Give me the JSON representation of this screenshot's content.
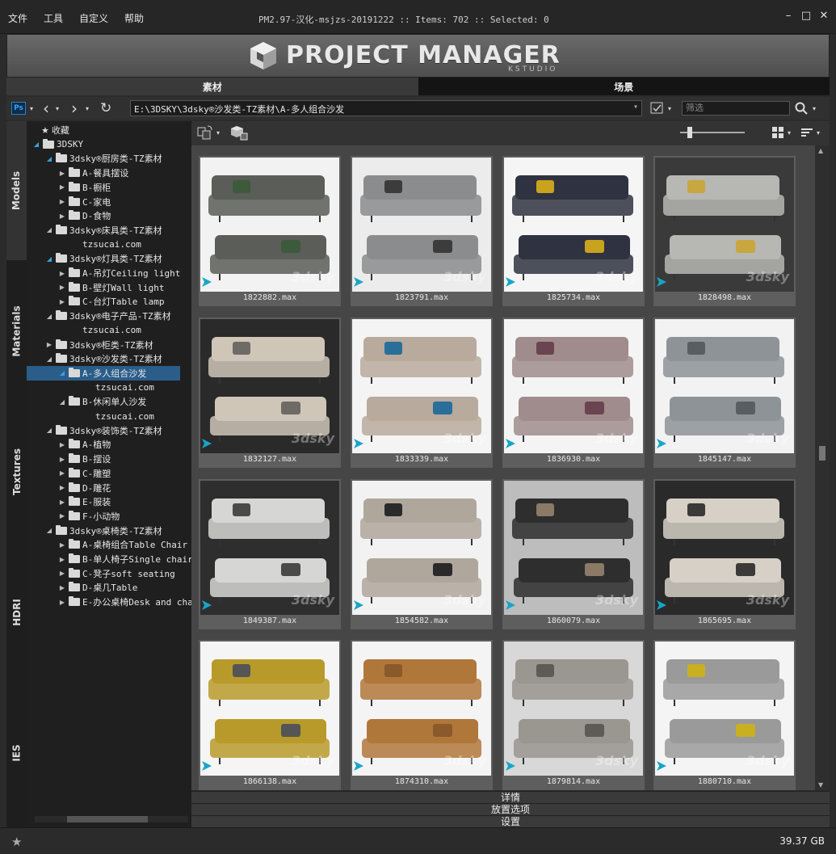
{
  "menu": [
    "文件",
    "工具",
    "自定义",
    "帮助"
  ],
  "window_title": "PM2.97-汉化-msjzs-20191222  :: Items: 702  :: Selected: 0",
  "logo": {
    "title": "PROJECT MANAGER",
    "subtitle": "KSTUDIO"
  },
  "main_tabs": [
    {
      "label": "素材",
      "active": true
    },
    {
      "label": "场景",
      "active": false
    }
  ],
  "address": {
    "path": "E:\\3DSKY\\3dsky®沙发类-TZ素材\\A-多人组合沙发",
    "filter_placeholder": "筛选"
  },
  "side_tabs": [
    "Models",
    "Materials",
    "Textures",
    "HDRI",
    "IES"
  ],
  "tree": [
    {
      "label": "收藏",
      "level": 0,
      "arrow": "",
      "star": true
    },
    {
      "label": "3DSKY",
      "level": 0,
      "arrow": "open"
    },
    {
      "label": "3dsky®厨房类-TZ素材",
      "level": 1,
      "arrow": "open"
    },
    {
      "label": "A-餐具摆设",
      "level": 2,
      "arrow": "closed"
    },
    {
      "label": "B-橱柜",
      "level": 2,
      "arrow": "closed"
    },
    {
      "label": "C-家电",
      "level": 2,
      "arrow": "closed"
    },
    {
      "label": "D-食物",
      "level": 2,
      "arrow": "closed"
    },
    {
      "label": "3dsky®床具类-TZ素材",
      "level": 1,
      "arrow": "open2"
    },
    {
      "label": "tzsucai.com",
      "level": 2,
      "arrow": ""
    },
    {
      "label": "3dsky®灯具类-TZ素材",
      "level": 1,
      "arrow": "open"
    },
    {
      "label": "A-吊灯Ceiling light",
      "level": 2,
      "arrow": "closed"
    },
    {
      "label": "B-壁灯Wall light",
      "level": 2,
      "arrow": "closed"
    },
    {
      "label": "C-台灯Table lamp",
      "level": 2,
      "arrow": "closed"
    },
    {
      "label": "3dsky®电子产品-TZ素材",
      "level": 1,
      "arrow": "open2"
    },
    {
      "label": "tzsucai.com",
      "level": 2,
      "arrow": ""
    },
    {
      "label": "3dsky®柜类-TZ素材",
      "level": 1,
      "arrow": "closed"
    },
    {
      "label": "3dsky®沙发类-TZ素材",
      "level": 1,
      "arrow": "open2"
    },
    {
      "label": "A-多人组合沙发",
      "level": 2,
      "arrow": "open",
      "selected": true
    },
    {
      "label": "tzsucai.com",
      "level": 3,
      "arrow": ""
    },
    {
      "label": "B-休闲单人沙发",
      "level": 2,
      "arrow": "open2"
    },
    {
      "label": "tzsucai.com",
      "level": 3,
      "arrow": ""
    },
    {
      "label": "3dsky®装饰类-TZ素材",
      "level": 1,
      "arrow": "open2"
    },
    {
      "label": "A-植物",
      "level": 2,
      "arrow": "closed"
    },
    {
      "label": "B-摆设",
      "level": 2,
      "arrow": "closed"
    },
    {
      "label": "C-雕塑",
      "level": 2,
      "arrow": "closed"
    },
    {
      "label": "D-雕花",
      "level": 2,
      "arrow": "closed"
    },
    {
      "label": "E-服装",
      "level": 2,
      "arrow": "closed"
    },
    {
      "label": "F-小动物",
      "level": 2,
      "arrow": "closed"
    },
    {
      "label": "3dsky®桌椅类-TZ素材",
      "level": 1,
      "arrow": "open2"
    },
    {
      "label": "A-桌椅组合Table Chair",
      "level": 2,
      "arrow": "closed"
    },
    {
      "label": "B-单人椅子Single chair",
      "level": 2,
      "arrow": "closed"
    },
    {
      "label": "C-凳子soft seating",
      "level": 2,
      "arrow": "closed"
    },
    {
      "label": "D-桌几Table",
      "level": 2,
      "arrow": "closed"
    },
    {
      "label": "E-办公桌椅Desk and chair",
      "level": 2,
      "arrow": "closed"
    }
  ],
  "items": [
    {
      "file": "1822882.max",
      "colors": [
        "#f2f2f2",
        "#5a5d58",
        "#3e5a3c"
      ]
    },
    {
      "file": "1823791.max",
      "colors": [
        "#ececec",
        "#8a8c8e",
        "#3c3c3c"
      ]
    },
    {
      "file": "1825734.max",
      "colors": [
        "#f5f5f5",
        "#2f3240",
        "#c9a21e"
      ]
    },
    {
      "file": "1828498.max",
      "colors": [
        "#3a3a3a",
        "#b7b7b4",
        "#c8a640"
      ]
    },
    {
      "file": "1832127.max",
      "colors": [
        "#2a2a2a",
        "#cfc6b8",
        "#6e6a66"
      ]
    },
    {
      "file": "1833339.max",
      "colors": [
        "#f4f4f4",
        "#b8aa9c",
        "#2a6e9a"
      ]
    },
    {
      "file": "1836930.max",
      "colors": [
        "#f4f4f4",
        "#a08c8c",
        "#6a4450"
      ]
    },
    {
      "file": "1845147.max",
      "colors": [
        "#f2f2f2",
        "#8e9398",
        "#5a5e62"
      ]
    },
    {
      "file": "1849387.max",
      "colors": [
        "#2e2e2e",
        "#d6d6d4",
        "#4a4a4a"
      ]
    },
    {
      "file": "1854582.max",
      "colors": [
        "#f2f2f2",
        "#b0a79c",
        "#2a2a2a"
      ]
    },
    {
      "file": "1860079.max",
      "colors": [
        "#bdbdbd",
        "#2e2e2e",
        "#8a7a66"
      ]
    },
    {
      "file": "1865695.max",
      "colors": [
        "#2a2a2a",
        "#d6d0c6",
        "#3c3a38"
      ]
    },
    {
      "file": "1866138.max",
      "colors": [
        "#f5f5f5",
        "#b89a2a",
        "#555"
      ]
    },
    {
      "file": "1874310.max",
      "colors": [
        "#f4f4f4",
        "#b0773a",
        "#8a5a2a"
      ]
    },
    {
      "file": "1879814.max",
      "colors": [
        "#d8d8d8",
        "#9a9690",
        "#5e5a56"
      ]
    },
    {
      "file": "1880710.max",
      "colors": [
        "#f4f4f4",
        "#9a9a9a",
        "#c8b020"
      ]
    }
  ],
  "watermark": "3dsky",
  "accordions": [
    "详情",
    "放置选项",
    "设置"
  ],
  "status": {
    "disk_free": "39.37 GB"
  }
}
